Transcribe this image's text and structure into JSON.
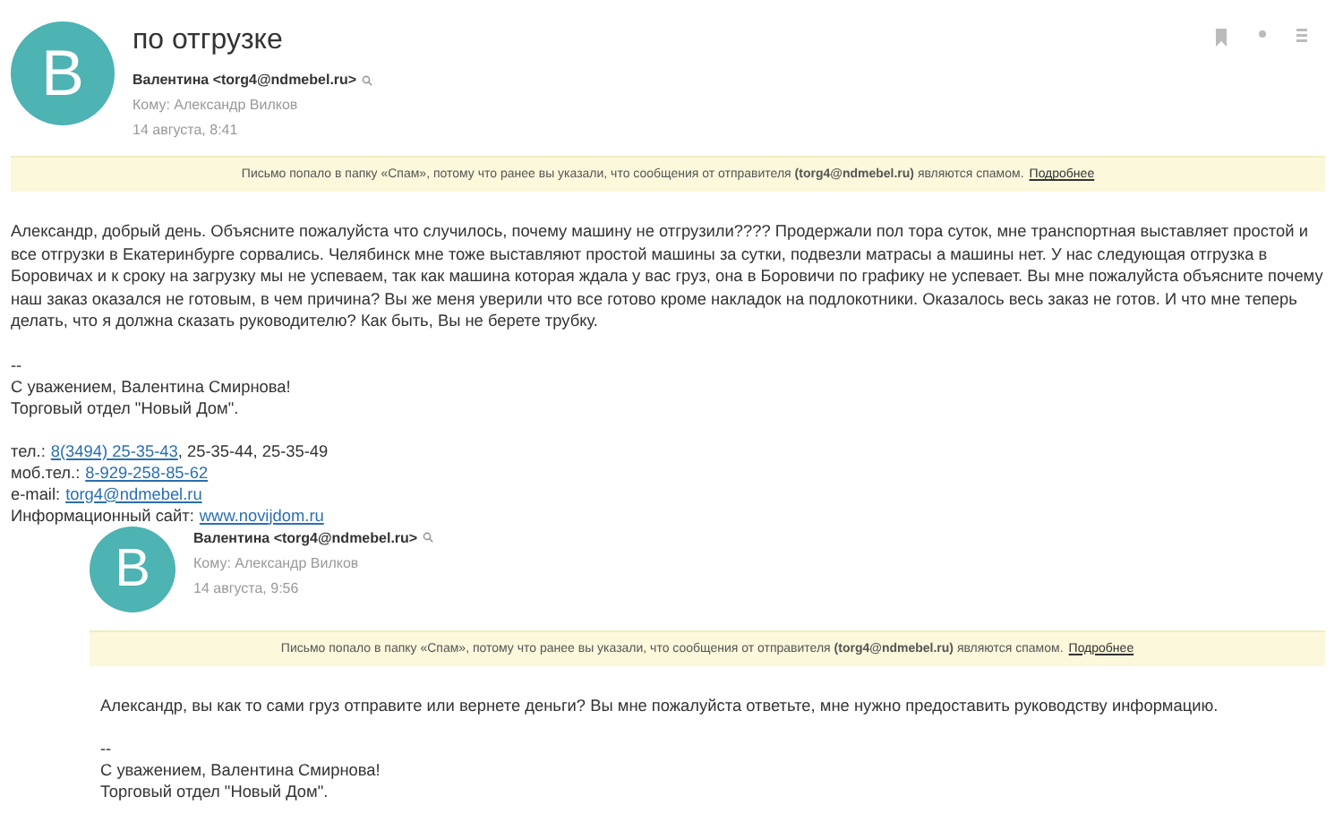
{
  "subject": "по отгрузке",
  "messages": [
    {
      "avatar": "В",
      "from": "Валентина <torg4@ndmebel.ru>",
      "to": "Кому: Александр Вилков",
      "date": "14 августа, 8:41",
      "spam_notice": "Письмо попало в папку «Спам», потому что ранее вы указали, что сообщения от отправителя **(torg4@ndmebel.ru)** являются спамом.",
      "spam_link": "Подробнее",
      "indented": false,
      "body": [
        "Александр, добрый день. Объясните пожалуйста что случилось, почему машину не отгрузили???? Продержали пол тора суток, мне транспортная выставляет простой и все отгрузки в Екатеринбурге сорвались. Челябинск мне тоже выставляют простой машины за сутки, подвезли матрасы а машины нет. У нас следующая отгрузка в Боровичах и к сроку на загрузку мы не успеваем, так как машина которая ждала у вас груз, она в Боровичи по графику не успевает. Вы мне пожалуйста объясните почему наш заказ оказался не готовым, в чем причина? Вы же меня уверили что все готово кроме накладок на подлокотники. Оказалось весь заказ не готов. И что мне теперь делать, что я должна сказать руководителю? Как быть, Вы не берете трубку."
      ],
      "signature": [
        "--",
        "С уважением, Валентина Смирнова!",
        "Торговый отдел \"Новый Дом\"."
      ],
      "contacts": [
        {
          "label": "тел.:",
          "parts": [
            {
              "text": "8(3494) 25-35-43",
              "link": true
            },
            {
              "text": ", 25-35-44, 25-35-49",
              "link": false
            }
          ]
        },
        {
          "label": "моб.тел.:",
          "parts": [
            {
              "text": "8-929-258-85-62",
              "link": true
            }
          ]
        },
        {
          "label": "e-mail:",
          "parts": [
            {
              "text": "torg4@ndmebel.ru",
              "link": true
            }
          ]
        },
        {
          "label": "Информационный сайт:",
          "parts": [
            {
              "text": "www.novijdom.ru",
              "link": true
            }
          ]
        }
      ]
    },
    {
      "avatar": "В",
      "from": "Валентина <torg4@ndmebel.ru>",
      "to": "Кому: Александр Вилков",
      "date": "14 августа, 9:56",
      "spam_notice": "Письмо попало в папку «Спам», потому что ранее вы указали, что сообщения от отправителя **(torg4@ndmebel.ru)** являются спамом.",
      "spam_link": "Подробнее",
      "indented": true,
      "body": [
        "Александр, вы как то сами груз отправите или вернете деньги? Вы мне пожалуйста ответьте, мне нужно предоставить руководству информацию."
      ],
      "signature": [
        "--",
        "С уважением, Валентина Смирнова!",
        "Торговый отдел \"Новый Дом\"."
      ]
    }
  ]
}
